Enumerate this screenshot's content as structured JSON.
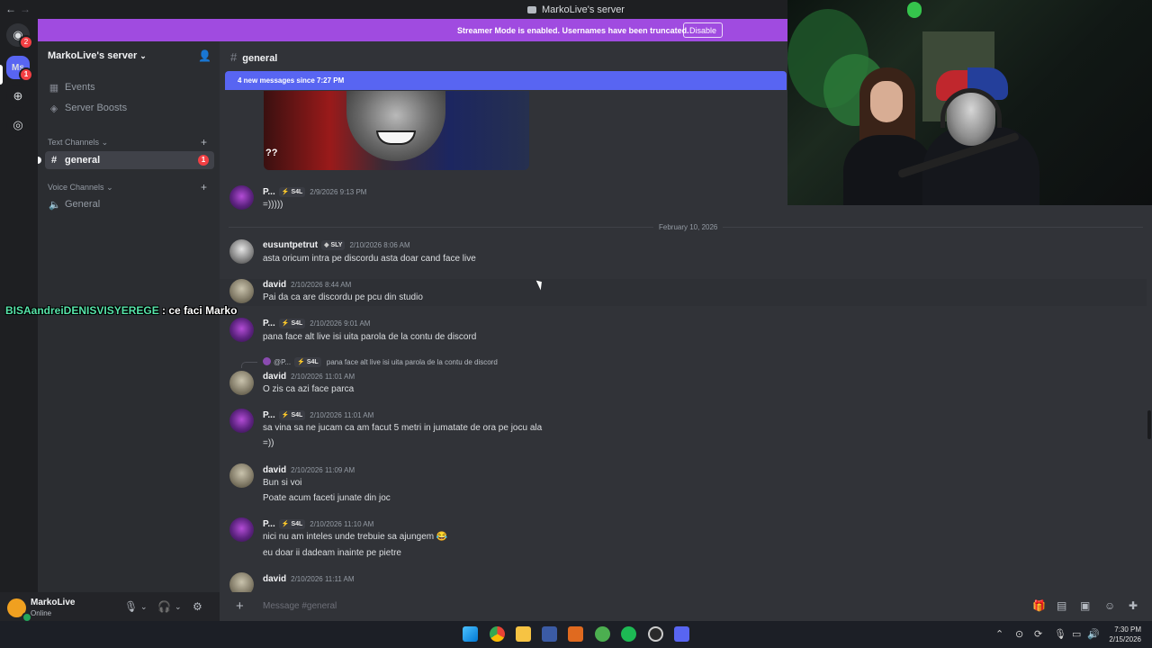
{
  "window": {
    "title": "MarkoLive's server"
  },
  "rail": {
    "badge_top": "2",
    "ms_label": "Ms",
    "ms_badge": "1"
  },
  "banner": {
    "text": "Streamer Mode is enabled. Usernames have been truncated.",
    "button": "Disable"
  },
  "sidebar": {
    "server_name": "MarkoLive's server",
    "items": [
      {
        "label": "Events",
        "icon": "calendar-icon"
      },
      {
        "label": "Server Boosts",
        "icon": "boost-icon"
      }
    ],
    "text_category": "Text Channels",
    "text_channels": [
      {
        "label": "general",
        "badge": "1"
      }
    ],
    "voice_category": "Voice Channels",
    "voice_channels": [
      {
        "label": "General"
      }
    ]
  },
  "user": {
    "name": "MarkoLive",
    "status": "Online"
  },
  "chat": {
    "channel": "general",
    "new_messages": "4 new messages since 7:27 PM",
    "image_caption": "??",
    "date_divider": "February 10, 2026",
    "messages": [
      {
        "author": "P...",
        "tag": "S4L",
        "time": "2/9/2026 9:13 PM",
        "lines": [
          "=)))))"
        ]
      },
      {
        "author": "eusuntpetrut",
        "tag": "SLY",
        "time": "2/10/2026 8:06 AM",
        "lines": [
          "asta oricum intra pe discordu asta doar cand face live"
        ]
      },
      {
        "author": "david",
        "tag": "",
        "time": "2/10/2026 8:44 AM",
        "lines": [
          "Pai da ca are discordu pe pcu din studio"
        ]
      },
      {
        "author": "P...",
        "tag": "S4L",
        "time": "2/10/2026 9:01 AM",
        "lines": [
          "pana face alt live isi uita parola de la contu de discord"
        ]
      },
      {
        "author": "david",
        "tag": "",
        "time": "2/10/2026 11:01 AM",
        "lines": [
          "O zis ca azi face parca"
        ]
      },
      {
        "author": "P...",
        "tag": "S4L",
        "time": "2/10/2026 11:01 AM",
        "lines": [
          "sa vina sa ne jucam ca am facut 5 metri in jumatate de ora pe jocu ala",
          "=))"
        ]
      },
      {
        "author": "david",
        "tag": "",
        "time": "2/10/2026 11:09 AM",
        "lines": [
          "Bun si voi",
          "Poate acum faceti junate din joc"
        ]
      },
      {
        "author": "P...",
        "tag": "S4L",
        "time": "2/10/2026 11:10 AM",
        "lines": [
          "nici nu am inteles unde trebuie sa ajungem 😂",
          "eu doar ii dadeam inainte pe pietre"
        ]
      },
      {
        "author": "david",
        "tag": "",
        "time": "2/10/2026 11:11 AM",
        "lines": []
      }
    ],
    "reply": {
      "author": "@P...",
      "tag": "S4L",
      "text": "pana face alt live isi uita parola de la contu de discord"
    },
    "composer_placeholder": "Message #general"
  },
  "overlay": {
    "user": "BISAandreiDENISVISYEREGE",
    "message": " : ce faci Marko"
  },
  "taskbar": {
    "time": "7:30 PM",
    "date": "2/15/2026"
  }
}
